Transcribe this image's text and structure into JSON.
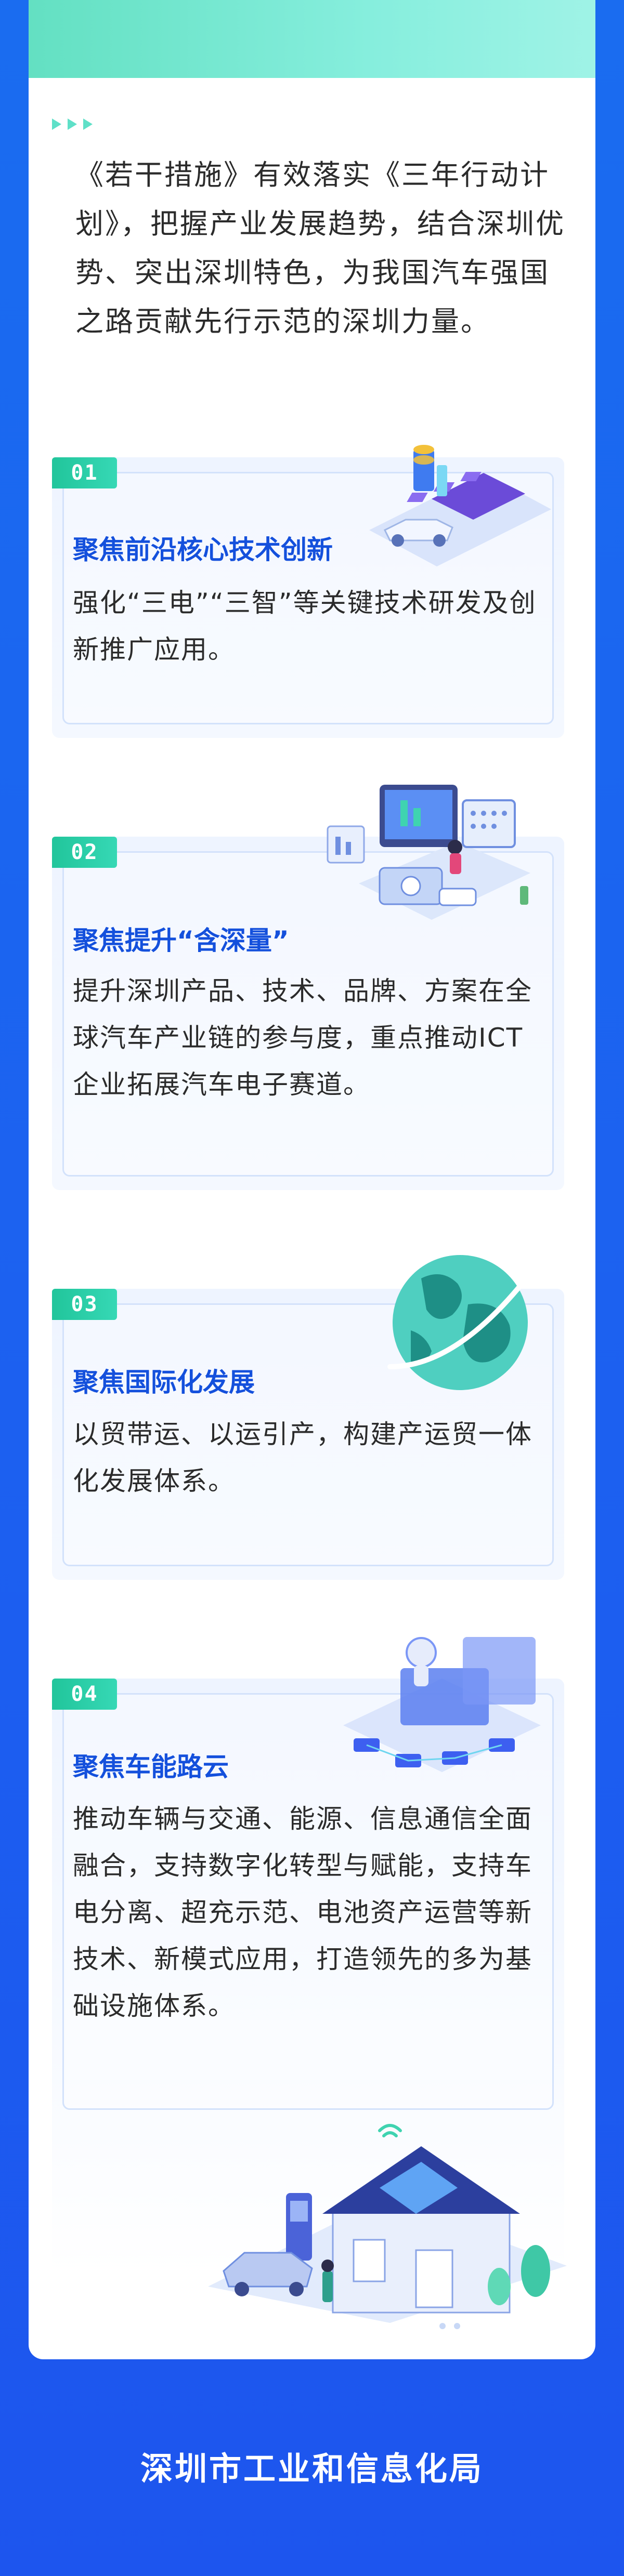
{
  "intro": {
    "text": "《若干措施》有效落实《三年行动计划》，把握产业发展趋势，结合深圳优势、突出深圳特色，为我国汽车强国之路贡献先行示范的深圳力量。"
  },
  "cards": [
    {
      "badge": "01",
      "title": "聚焦前沿核心技术创新",
      "body": "强化“三电”“三智”等关键技术研发及创新推广应用。"
    },
    {
      "badge": "02",
      "title": "聚焦提升“含深量”",
      "body": "提升深圳产品、技术、品牌、方案在全球汽车产业链的参与度，重点推动ICT企业拓展汽车电子赛道。"
    },
    {
      "badge": "03",
      "title": "聚焦国际化发展",
      "body": "以贸带运、以运引产，构建产运贸一体化发展体系。"
    },
    {
      "badge": "04",
      "title": "聚焦车能路云",
      "body": "推动车辆与交通、能源、信息通信全面融合，支持数字化转型与赋能，支持车电分离、超充示范、电池资产运营等新技术、新模式应用，打造领先的多为基础设施体系。"
    }
  ],
  "footer": {
    "org": "深圳市工业和信息化局"
  },
  "colors": {
    "accent": "#1450dc",
    "badge": "#21c59b",
    "background": "#1a6cf0"
  }
}
